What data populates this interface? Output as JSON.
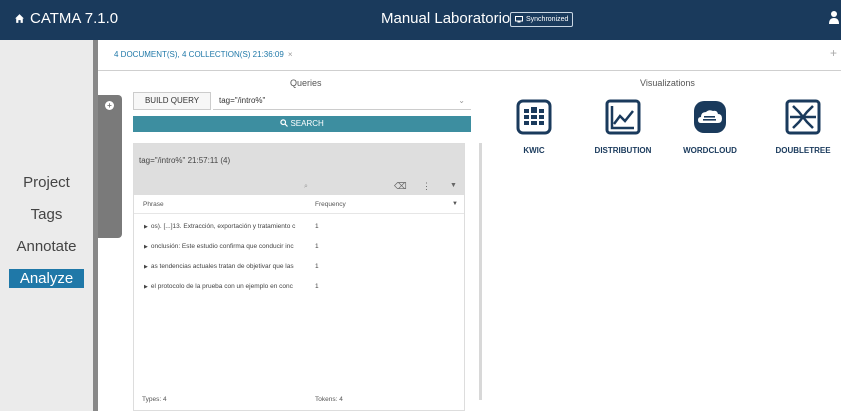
{
  "topbar": {
    "brand": "CATMA 7.1.0",
    "title": "Manual Laboratorio",
    "sync_label": "Synchronized"
  },
  "sidebar": {
    "items": [
      {
        "label": "Project"
      },
      {
        "label": "Tags"
      },
      {
        "label": "Annotate"
      },
      {
        "label": "Analyze",
        "active": true
      }
    ]
  },
  "tabs": {
    "active": "4 DOCUMENT(S), 4 COLLECTION(S) 21:36:09",
    "close": "×",
    "add": "+"
  },
  "queries": {
    "title": "Queries",
    "build_label": "BUILD QUERY",
    "query_value": "tag=\"/intro%\"",
    "search_label": "SEARCH"
  },
  "result": {
    "header": "tag=\"/intro%\" 21:57:11 (4)",
    "filter_placeholder": "⌕",
    "columns": {
      "phrase": "Phrase",
      "frequency": "Frequency"
    },
    "rows": [
      {
        "phrase": "os). [...]13. Extracción, exportación y tratamiento c",
        "freq": "1"
      },
      {
        "phrase": "onclusión: Este estudio confirma que conducir inc",
        "freq": "1"
      },
      {
        "phrase": "as tendencias actuales tratan de objetivar que las",
        "freq": "1"
      },
      {
        "phrase": "el protocolo de la prueba con un ejemplo en conc",
        "freq": "1"
      }
    ],
    "types": "Types: 4",
    "tokens": "Tokens: 4"
  },
  "visualizations": {
    "title": "Visualizations",
    "items": [
      {
        "label": "KWIC",
        "icon": "kwic-icon"
      },
      {
        "label": "DISTRIBUTION",
        "icon": "distribution-icon"
      },
      {
        "label": "WORDCLOUD",
        "icon": "wordcloud-icon"
      },
      {
        "label": "DOUBLETREE",
        "icon": "doubletree-icon"
      }
    ]
  },
  "colors": {
    "topbar": "#1a3a5c",
    "accent": "#1f78a8",
    "search": "#3d8ea0",
    "panel": "#dedede"
  }
}
